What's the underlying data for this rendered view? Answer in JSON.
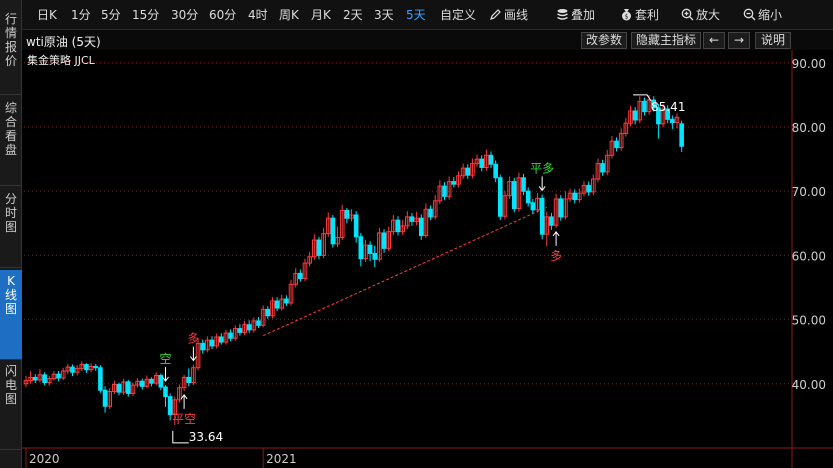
{
  "sidebar": {
    "tabs": [
      {
        "label": "行情报价",
        "active": false
      },
      {
        "label": "综合看盘",
        "active": false
      },
      {
        "label": "分时图",
        "active": false
      },
      {
        "label": "K线图",
        "active": true
      },
      {
        "label": "闪电图",
        "active": false
      }
    ]
  },
  "toolbar": {
    "period_buttons": [
      "日K",
      "1分",
      "5分",
      "15分",
      "30分",
      "60分",
      "4时",
      "周K",
      "月K",
      "2天",
      "3天",
      "5天"
    ],
    "active_period": "5天",
    "custom_label": "自定义",
    "draw_label": "画线",
    "overlay_label": "叠加",
    "arbitrage_label": "套利",
    "zoom_in_label": "放大",
    "zoom_out_label": "缩小"
  },
  "subbar": {
    "symbol": "wti原油 (5天)",
    "edit_params": "改参数",
    "hide_main": "隐藏主指标",
    "prev_arrow": "←",
    "next_arrow": "→",
    "help": "说明"
  },
  "strategy_label": "集金策略 JJCL",
  "colors": {
    "up": "#ff3b3b",
    "down": "#00e5ff",
    "background": "#000000",
    "grid": "#8b1a1a",
    "trendline": "#ff3b3b",
    "signal_long": "#ff3b3b",
    "signal_short": "#33dd33",
    "active_tab": "#1e6fc4"
  },
  "chart_data": {
    "type": "candlestick",
    "y_ticks": [
      "40.00",
      "50.00",
      "60.00",
      "70.00",
      "80.00",
      "90.00"
    ],
    "ylim": [
      30,
      92
    ],
    "x_ticks": [
      {
        "label": "2020",
        "index": 0
      },
      {
        "label": "2021",
        "index": 51
      }
    ],
    "grid": true,
    "candles": [
      [
        40.0,
        40.5,
        41.2,
        39.5
      ],
      [
        40.5,
        41.0,
        42.0,
        40.0
      ],
      [
        41.0,
        40.6,
        41.5,
        40.1
      ],
      [
        40.6,
        41.4,
        42.3,
        40.2
      ],
      [
        41.4,
        40.2,
        41.8,
        39.8
      ],
      [
        40.2,
        40.8,
        41.2,
        39.7
      ],
      [
        40.8,
        41.5,
        42.0,
        40.5
      ],
      [
        41.5,
        40.9,
        42.0,
        40.4
      ],
      [
        40.9,
        42.0,
        42.5,
        40.6
      ],
      [
        42.0,
        42.6,
        43.1,
        41.5
      ],
      [
        42.6,
        41.8,
        43.0,
        41.2
      ],
      [
        41.8,
        42.4,
        42.9,
        41.3
      ],
      [
        42.4,
        43.0,
        43.5,
        42.0
      ],
      [
        43.0,
        42.2,
        43.2,
        41.7
      ],
      [
        42.2,
        42.7,
        43.2,
        41.8
      ],
      [
        42.7,
        42.5,
        43.1,
        42.0
      ],
      [
        42.5,
        39.0,
        42.9,
        38.6
      ],
      [
        39.0,
        36.5,
        39.6,
        35.5
      ],
      [
        36.5,
        38.8,
        39.3,
        36.1
      ],
      [
        38.8,
        39.9,
        40.5,
        38.4
      ],
      [
        39.9,
        38.7,
        40.2,
        38.2
      ],
      [
        38.7,
        40.3,
        40.8,
        38.3
      ],
      [
        40.3,
        38.5,
        40.6,
        38.0
      ],
      [
        38.5,
        39.8,
        40.2,
        38.1
      ],
      [
        39.8,
        40.4,
        40.9,
        39.4
      ],
      [
        40.4,
        39.6,
        40.8,
        39.1
      ],
      [
        39.6,
        40.7,
        41.3,
        39.3
      ],
      [
        40.7,
        40.1,
        41.0,
        39.6
      ],
      [
        40.1,
        41.3,
        41.8,
        39.8
      ],
      [
        41.3,
        39.5,
        41.6,
        39.0
      ],
      [
        39.5,
        38.0,
        39.8,
        36.4
      ],
      [
        38.0,
        35.2,
        38.5,
        34.3
      ],
      [
        35.2,
        37.5,
        38.0,
        33.6
      ],
      [
        37.5,
        39.4,
        39.9,
        37.1
      ],
      [
        39.4,
        41.0,
        41.4,
        38.9
      ],
      [
        41.0,
        40.2,
        42.4,
        39.6
      ],
      [
        40.2,
        42.5,
        43.0,
        39.8
      ],
      [
        42.5,
        46.3,
        47.0,
        42.1
      ],
      [
        46.3,
        45.3,
        46.9,
        44.7
      ],
      [
        45.3,
        46.8,
        47.4,
        44.9
      ],
      [
        46.8,
        45.9,
        47.4,
        45.4
      ],
      [
        45.9,
        47.3,
        47.8,
        45.5
      ],
      [
        47.3,
        46.5,
        47.9,
        46.1
      ],
      [
        46.5,
        47.9,
        48.4,
        46.1
      ],
      [
        47.9,
        47.1,
        48.5,
        46.6
      ],
      [
        47.1,
        48.6,
        49.1,
        46.7
      ],
      [
        48.6,
        48.0,
        49.3,
        47.5
      ],
      [
        48.0,
        49.2,
        49.8,
        47.6
      ],
      [
        49.2,
        48.4,
        49.9,
        47.9
      ],
      [
        48.4,
        49.8,
        50.3,
        48.0
      ],
      [
        49.8,
        49.1,
        50.4,
        48.7
      ],
      [
        49.1,
        51.6,
        52.2,
        48.8
      ],
      [
        51.6,
        50.6,
        52.1,
        50.1
      ],
      [
        50.6,
        52.9,
        53.5,
        50.2
      ],
      [
        52.9,
        51.8,
        53.5,
        51.3
      ],
      [
        51.8,
        53.2,
        53.9,
        51.4
      ],
      [
        53.2,
        52.6,
        53.8,
        52.1
      ],
      [
        52.6,
        55.5,
        56.2,
        52.2
      ],
      [
        55.5,
        57.2,
        58.0,
        55.0
      ],
      [
        57.2,
        56.4,
        57.8,
        55.9
      ],
      [
        56.4,
        58.8,
        59.5,
        56.0
      ],
      [
        58.8,
        59.8,
        60.5,
        58.3
      ],
      [
        59.8,
        62.4,
        63.3,
        59.3
      ],
      [
        62.4,
        60.0,
        62.9,
        59.4
      ],
      [
        60.0,
        63.4,
        64.3,
        59.6
      ],
      [
        63.4,
        65.8,
        66.7,
        62.9
      ],
      [
        65.8,
        61.8,
        66.3,
        61.2
      ],
      [
        61.8,
        62.8,
        64.5,
        61.3
      ],
      [
        62.8,
        67.0,
        67.9,
        62.4
      ],
      [
        67.0,
        65.8,
        67.4,
        65.0
      ],
      [
        65.8,
        66.3,
        67.2,
        65.3
      ],
      [
        66.3,
        62.9,
        66.9,
        62.0
      ],
      [
        62.9,
        59.5,
        63.5,
        58.3
      ],
      [
        59.5,
        61.6,
        62.4,
        59.0
      ],
      [
        61.6,
        60.3,
        62.2,
        59.1
      ],
      [
        60.3,
        59.4,
        61.5,
        58.2
      ],
      [
        59.4,
        63.5,
        64.3,
        59.0
      ],
      [
        63.5,
        61.1,
        64.1,
        60.4
      ],
      [
        61.1,
        63.7,
        64.5,
        60.7
      ],
      [
        63.7,
        65.5,
        66.3,
        63.2
      ],
      [
        65.5,
        63.7,
        66.1,
        63.1
      ],
      [
        63.7,
        64.6,
        65.5,
        63.2
      ],
      [
        64.6,
        66.0,
        66.9,
        64.1
      ],
      [
        66.0,
        65.3,
        66.6,
        64.6
      ],
      [
        65.3,
        65.8,
        66.8,
        64.7
      ],
      [
        65.8,
        63.1,
        66.4,
        62.4
      ],
      [
        63.1,
        67.2,
        68.1,
        62.7
      ],
      [
        67.2,
        66.0,
        67.8,
        65.5
      ],
      [
        66.0,
        68.5,
        69.4,
        65.6
      ],
      [
        68.5,
        70.8,
        71.7,
        68.0
      ],
      [
        70.8,
        69.2,
        71.4,
        68.6
      ],
      [
        69.2,
        71.5,
        72.3,
        68.7
      ],
      [
        71.5,
        71.1,
        72.2,
        70.6
      ],
      [
        71.1,
        72.4,
        73.1,
        70.6
      ],
      [
        72.4,
        73.6,
        74.3,
        71.9
      ],
      [
        73.6,
        72.5,
        74.2,
        71.9
      ],
      [
        72.5,
        74.3,
        75.1,
        72.0
      ],
      [
        74.3,
        75.0,
        75.7,
        73.8
      ],
      [
        75.0,
        73.7,
        75.6,
        73.1
      ],
      [
        73.7,
        75.6,
        76.5,
        73.2
      ],
      [
        75.6,
        74.2,
        76.2,
        73.6
      ],
      [
        74.2,
        72.1,
        74.8,
        71.4
      ],
      [
        72.1,
        66.1,
        72.6,
        65.5
      ],
      [
        66.1,
        69.3,
        70.1,
        65.6
      ],
      [
        69.3,
        71.5,
        72.3,
        68.8
      ],
      [
        71.5,
        67.3,
        72.1,
        66.7
      ],
      [
        67.3,
        72.1,
        72.9,
        66.8
      ],
      [
        72.1,
        70.0,
        72.7,
        69.4
      ],
      [
        70.0,
        68.2,
        70.6,
        67.6
      ],
      [
        68.2,
        67.1,
        68.8,
        66.5
      ],
      [
        67.1,
        68.9,
        69.7,
        66.7
      ],
      [
        68.9,
        63.3,
        69.5,
        62.5
      ],
      [
        63.3,
        66.0,
        66.8,
        61.4
      ],
      [
        66.0,
        64.7,
        66.6,
        64.0
      ],
      [
        64.7,
        68.8,
        69.6,
        64.3
      ],
      [
        68.8,
        66.0,
        69.4,
        65.4
      ],
      [
        66.0,
        68.8,
        70.0,
        65.6
      ],
      [
        68.8,
        69.7,
        70.4,
        68.3
      ],
      [
        69.7,
        68.7,
        70.3,
        68.1
      ],
      [
        68.7,
        69.7,
        70.4,
        68.2
      ],
      [
        69.7,
        70.9,
        71.6,
        69.2
      ],
      [
        70.9,
        69.9,
        71.5,
        69.3
      ],
      [
        69.9,
        71.9,
        72.6,
        69.4
      ],
      [
        71.9,
        74.3,
        75.1,
        71.4
      ],
      [
        74.3,
        73.0,
        74.9,
        72.4
      ],
      [
        73.0,
        75.6,
        76.4,
        72.5
      ],
      [
        75.6,
        77.8,
        78.6,
        75.1
      ],
      [
        77.8,
        76.8,
        78.4,
        76.2
      ],
      [
        76.8,
        79.0,
        79.8,
        76.3
      ],
      [
        79.0,
        80.6,
        81.4,
        78.5
      ],
      [
        80.6,
        82.5,
        83.3,
        80.1
      ],
      [
        82.5,
        81.1,
        83.1,
        80.4
      ],
      [
        81.1,
        84.0,
        84.8,
        80.6
      ],
      [
        84.0,
        82.4,
        84.6,
        81.8
      ],
      [
        82.4,
        84.2,
        85.0,
        81.9
      ],
      [
        84.2,
        83.0,
        84.8,
        82.4
      ],
      [
        83.0,
        80.5,
        83.6,
        78.2
      ],
      [
        80.5,
        82.8,
        83.6,
        80.0
      ],
      [
        82.8,
        81.2,
        83.4,
        80.6
      ],
      [
        81.2,
        80.7,
        81.8,
        79.7
      ],
      [
        80.7,
        81.5,
        82.1,
        79.8
      ],
      [
        80.5,
        77.0,
        81.0,
        76.1
      ]
    ],
    "trendline": {
      "from": [
        51,
        47.5
      ],
      "to": [
        112,
        67.5
      ]
    },
    "signals": [
      {
        "label": "空",
        "index": 30,
        "direction": "short",
        "position": "above"
      },
      {
        "label": "平空",
        "index": 34,
        "direction": "long",
        "position": "below"
      },
      {
        "label": "多",
        "index": 36,
        "direction": "long",
        "position": "above"
      },
      {
        "label": "平多",
        "index": 111,
        "direction": "short",
        "position": "above"
      },
      {
        "label": "多",
        "index": 114,
        "direction": "long",
        "position": "below"
      }
    ],
    "low_marker": {
      "label": "33.64",
      "index": 32
    },
    "high_marker": {
      "label": "85.41",
      "index": 134
    }
  }
}
